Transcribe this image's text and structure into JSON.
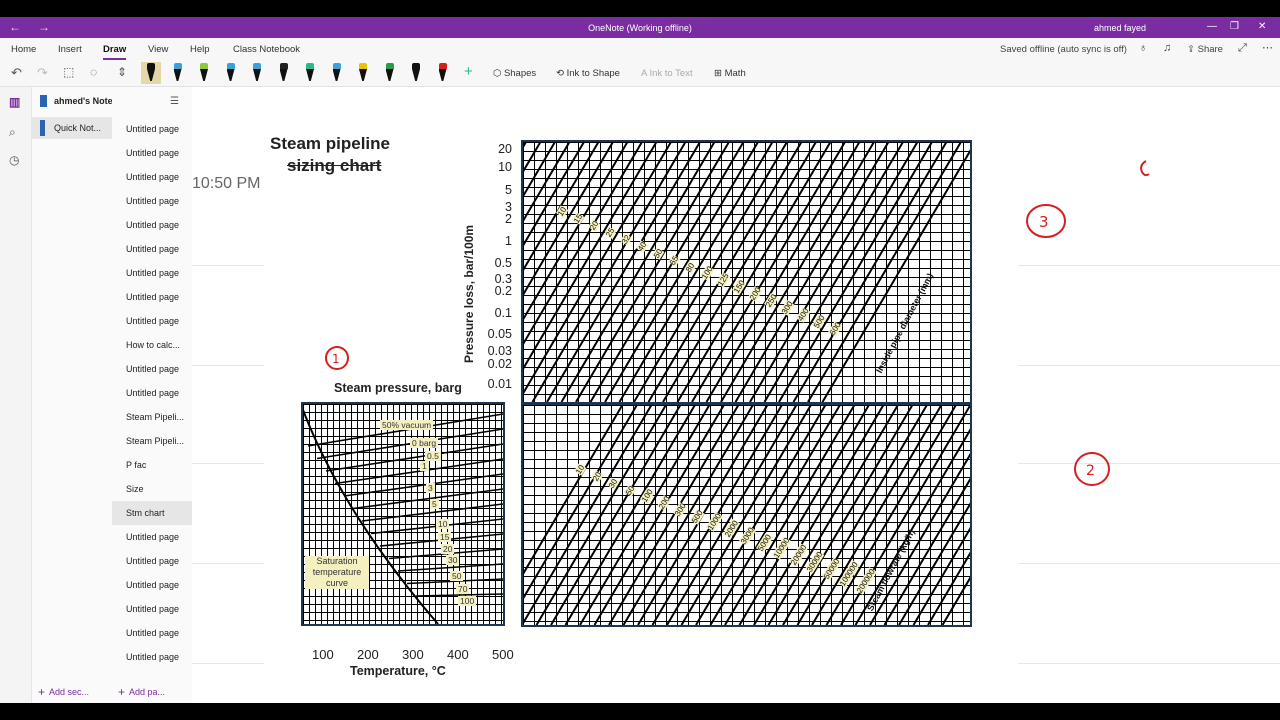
{
  "window": {
    "title": "OneNote (Working offline)",
    "user": "ahmed fayed"
  },
  "menu": {
    "tabs": [
      "Home",
      "Insert",
      "Draw",
      "View",
      "Help",
      "Class Notebook"
    ],
    "active": "Draw",
    "status": "Saved offline (auto sync is off)",
    "share": "Share"
  },
  "ribbon": {
    "shapes": "Shapes",
    "ink_to_shape": "Ink to Shape",
    "ink_to_text": "Ink to Text",
    "math": "Math",
    "pen_colors": [
      "#111111",
      "#3aa0d8",
      "#8dc63f",
      "#3aa0d8",
      "#3aa0d8",
      "#222222",
      "#2eb88a",
      "#3aa0d8",
      "#e8c400",
      "#2a9d4a",
      "#111111",
      "#d42020"
    ]
  },
  "notebook": {
    "name": "ahmed's Notebook",
    "section": "Quick Not...",
    "add_section": "Add sec...",
    "add_page": "Add pa..."
  },
  "pages": [
    "Untitled page",
    "Untitled page",
    "Untitled page",
    "Untitled page",
    "Untitled page",
    "Untitled page",
    "Untitled page",
    "Untitled page",
    "Untitled page",
    "How to calc...",
    "Untitled page",
    "Untitled page",
    "Steam Pipeli...",
    "Steam Pipeli...",
    "P fac",
    "Size",
    "Stm chart",
    "Untitled page",
    "Untitled page",
    "Untitled page",
    "Untitled page",
    "Untitled page",
    "Untitled page"
  ],
  "active_page_index": 16,
  "canvas": {
    "time": "10:50 PM",
    "title_line1": "Steam pipeline",
    "title_line2": "sizing chart"
  },
  "chart": {
    "steam_pressure_label": "Steam pressure, barg",
    "temperature_label": "Temperature, °C",
    "pressure_loss_label": "Pressure loss, bar/100m",
    "diameter_label": "Inside pipe diameter (mm)",
    "flowrate_label": "Steam flowrate (kg/h)",
    "saturation_label": "Saturation temperature curve",
    "temp_ticks": [
      "100",
      "200",
      "300",
      "400",
      "500"
    ],
    "loss_ticks": [
      "20",
      "10",
      "5",
      "3",
      "2",
      "1",
      "0.5",
      "0.3",
      "0.2",
      "0.1",
      "0.05",
      "0.03",
      "0.02",
      "0.01"
    ],
    "pressure_tags": [
      "50% vacuum",
      "0 barg",
      "0.5",
      "1",
      "3",
      "5",
      "10",
      "15",
      "20",
      "30",
      "50",
      "70",
      "100"
    ],
    "diameters": [
      "10",
      "15",
      "20",
      "25",
      "32",
      "40",
      "50",
      "65",
      "80",
      "100",
      "125",
      "150",
      "200",
      "250",
      "300",
      "400",
      "500",
      "600"
    ],
    "flowrates": [
      "10",
      "20",
      "30",
      "50",
      "100",
      "200",
      "300",
      "500",
      "1000",
      "2000",
      "3000",
      "5000",
      "10000",
      "20000",
      "30000",
      "50000",
      "100000",
      "200000"
    ]
  },
  "ink_marks": [
    "3",
    "1",
    "2"
  ]
}
